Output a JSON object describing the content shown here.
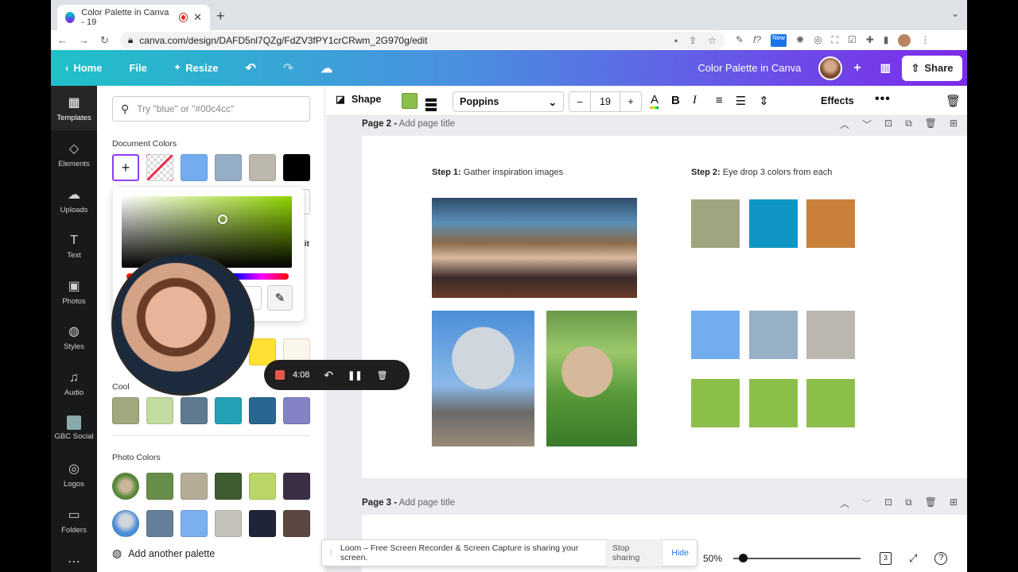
{
  "browser": {
    "tab_title": "Color Palette in Canva - 19",
    "url": "canva.com/design/DAFD5nl7QZg/FdZV3fPY1crCRwm_2G970g/edit",
    "extension_badge": "New"
  },
  "header": {
    "home": "Home",
    "file": "File",
    "resize": "Resize",
    "design_title": "Color Palette in Canva",
    "share": "Share"
  },
  "rail": [
    {
      "label": "Templates",
      "icon": "layout-icon"
    },
    {
      "label": "Elements",
      "icon": "shapes-icon"
    },
    {
      "label": "Uploads",
      "icon": "cloud-upload-icon"
    },
    {
      "label": "Text",
      "icon": "text-icon"
    },
    {
      "label": "Photos",
      "icon": "image-icon"
    },
    {
      "label": "Styles",
      "icon": "palette-icon"
    },
    {
      "label": "Audio",
      "icon": "music-icon"
    },
    {
      "label": "GBC Social",
      "icon": "folder-thumb-icon"
    },
    {
      "label": "Logos",
      "icon": "logo-icon"
    },
    {
      "label": "Folders",
      "icon": "folder-icon"
    }
  ],
  "panel": {
    "search_placeholder": "Try \"blue\" or \"#00c4cc\"",
    "document_colors_title": "Document Colors",
    "document_colors": [
      "#73adf0",
      "#95aec6",
      "#bcb8ae",
      "#000000"
    ],
    "partial_label": "lit",
    "cool_title": "Cool",
    "cool_colors": [
      "#a0a87e",
      "#c1dba0",
      "#5e7a8f",
      "#25a0b5",
      "#2a6790",
      "#8382c4"
    ],
    "photo_colors_title": "Photo Colors",
    "photo_colors_row1": [
      "#678e4b",
      "#b5ac98",
      "#3e5c30",
      "#bad668",
      "#3b2f45"
    ],
    "photo_colors_row2": [
      "#66809b",
      "#7ab0ed",
      "#c5c2bc",
      "#1f2438",
      "#5c4640"
    ],
    "partial_swatches": [
      "#ffe033",
      "#fbf6ea"
    ],
    "add_palette": "Add another palette"
  },
  "recorder": {
    "time": "4:08"
  },
  "toolbar": {
    "shape": "Shape",
    "fill_color": "#8cbf4a",
    "font": "Poppins",
    "font_size": "19",
    "effects": "Effects"
  },
  "pages": {
    "page2_label": "Page 2 -",
    "page3_label": "Page 3 -",
    "page_title_placeholder": "Add page title"
  },
  "canvas": {
    "step1_label": "Step 1:",
    "step1_text": " Gather inspiration images",
    "step2_label": "Step 2:",
    "step2_text": " Eye drop 3 colors from each",
    "row1_colors": [
      "#9ea57f",
      "#0f96c5",
      "#c8803a"
    ],
    "row2_colors": [
      "#72adf0",
      "#98b0c6",
      "#bbb7ae"
    ],
    "row3_colors": [
      "#8cbf4a",
      "#8cbf4a",
      "#8cbf4a"
    ]
  },
  "loom": {
    "message": "Loom – Free Screen Recorder & Screen Capture is sharing your screen.",
    "stop": "Stop sharing",
    "hide": "Hide"
  },
  "footer": {
    "zoom": "50%",
    "page_count": "3"
  }
}
